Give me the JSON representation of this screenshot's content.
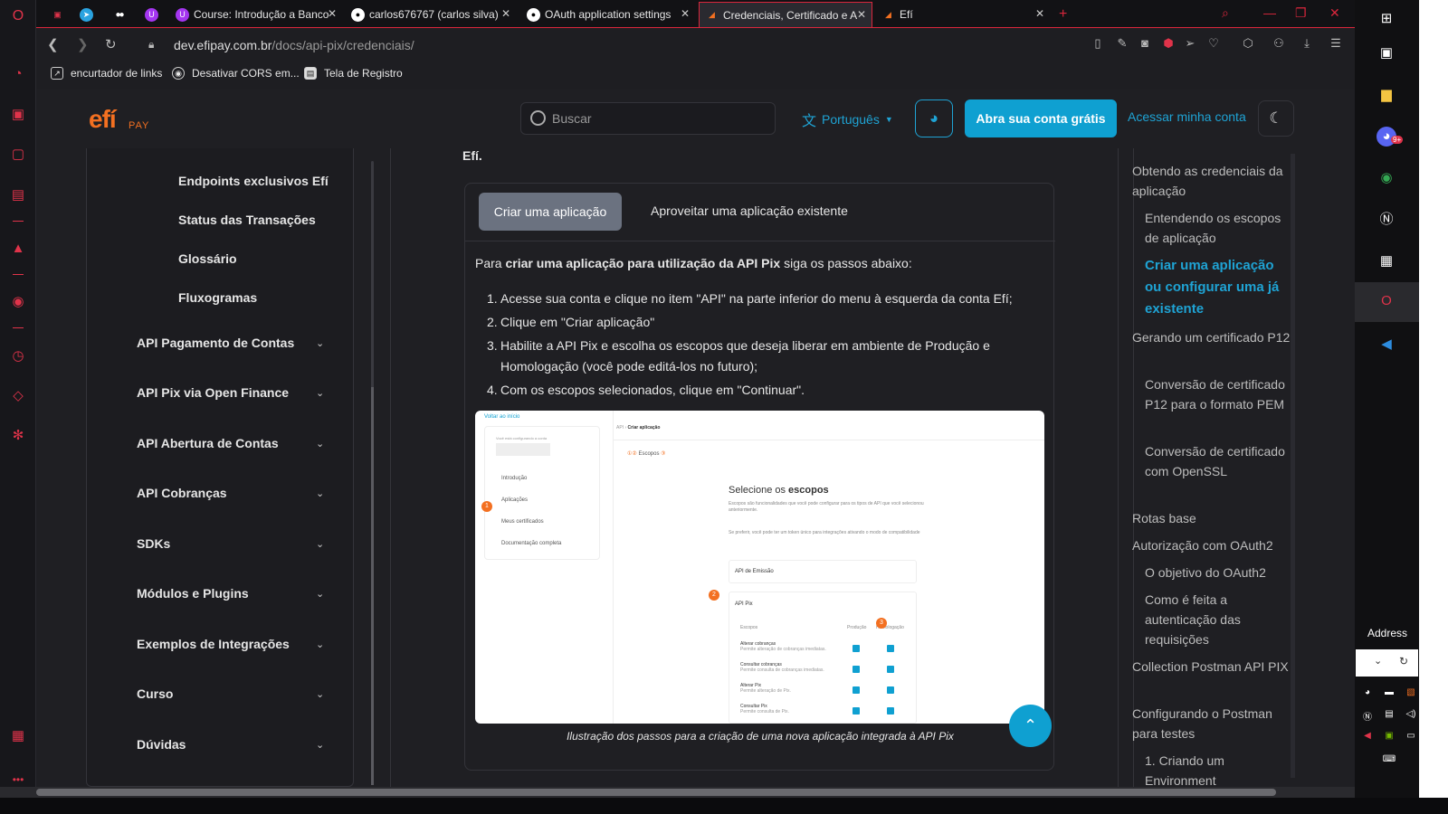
{
  "browser": {
    "tabs": [
      {
        "label": "",
        "icon": "gamepad-icon"
      },
      {
        "label": "",
        "icon": "telegram-icon"
      },
      {
        "label": "",
        "icon": "medium-icon"
      },
      {
        "label": "",
        "icon": "udemy-icon"
      },
      {
        "label": "Course: Introdução a Banco",
        "icon": "udemy-icon"
      },
      {
        "label": "carlos676767 (carlos silva)",
        "icon": "github-icon"
      },
      {
        "label": "OAuth application settings",
        "icon": "github-icon"
      },
      {
        "label": "Credenciais, Certificado e A",
        "icon": "efi-icon"
      },
      {
        "label": "Efí",
        "icon": "efi-icon"
      }
    ],
    "new_tab": "+",
    "url_domain": "dev.efipay.com.br",
    "url_path": "/docs/api-pix/credenciais/",
    "bookmarks": [
      "encurtador de links",
      "Desativar CORS em...",
      "Tela de Registro"
    ]
  },
  "header": {
    "logo": "efí",
    "logo_sub": "PAY",
    "search_placeholder": "Buscar",
    "language": "Português",
    "cta": "Abra sua conta grátis",
    "login": "Acessar minha conta"
  },
  "sidebar": {
    "sub_items": [
      "Endpoints exclusivos Efí",
      "Status das Transações",
      "Glossário",
      "Fluxogramas"
    ],
    "items": [
      "API Pagamento de Contas",
      "API Pix via Open Finance",
      "API Abertura de Contas",
      "API Cobranças",
      "SDKs",
      "Módulos e Plugins",
      "Exemplos de Integrações",
      "Curso",
      "Dúvidas"
    ]
  },
  "content": {
    "top_text": "Efí.",
    "tab_active": "Criar uma aplicação",
    "tab_other": "Aproveitar uma aplicação existente",
    "intro_prefix": "Para ",
    "intro_bold": "criar uma aplicação para utilização da API Pix",
    "intro_suffix": " siga os passos abaixo:",
    "steps": [
      "Acesse sua conta e clique no item \"API\" na parte inferior do menu à esquerda da conta Efí;",
      "Clique em \"Criar aplicação\"",
      "Habilite a API Pix e escolha os escopos que deseja liberar em ambiente de Produção e Homologação (você pode editá-los no futuro);",
      "Com os escopos selecionados, clique em \"Continuar\"."
    ],
    "caption": "Ilustração dos passos para a criação de uma nova aplicação integrada à API Pix",
    "screenshot": {
      "back": "Voltar ao início",
      "account_label": "Você está configurando a conta",
      "menu": [
        "Introdução",
        "Aplicações",
        "Meus certificados",
        "Documentação completa"
      ],
      "crumb": [
        "API",
        "Criar aplicação"
      ],
      "step_label": "Escopos",
      "heading_prefix": "Selecione os ",
      "heading_bold": "escopos",
      "desc1": "Escopos são funcionalidades que você pode configurar para os tipos de API que você selecionou anteriormente.",
      "desc2": "Se preferir, você pode ter um token único para integrações ativando o modo de compatibilidade",
      "api_emissao": "API de Emissão",
      "api_pix": "API Pix",
      "col_scopes": "Escopos",
      "col_prod": "Produção",
      "col_hom": "Homologação",
      "rows": [
        {
          "title": "Alterar cobranças",
          "desc": "Permite alteração de cobranças imediatas."
        },
        {
          "title": "Consultar cobranças",
          "desc": "Permite consulta de cobranças imediatas."
        },
        {
          "title": "Alterar Pix",
          "desc": "Permite alteração de Pix."
        },
        {
          "title": "Consultar Pix",
          "desc": "Permite consulta de Pix."
        }
      ],
      "markers": [
        "1",
        "2",
        "3"
      ]
    }
  },
  "toc": {
    "items": [
      {
        "label": "Obtendo as credenciais da aplicação",
        "level": 1
      },
      {
        "label": "Entendendo os escopos de aplicação",
        "level": 2
      },
      {
        "label": "Criar uma aplicação ou configurar uma já existente",
        "level": 2,
        "active": true
      },
      {
        "label": "Gerando um certificado P12",
        "level": 1
      },
      {
        "label": "Conversão de certificado P12 para o formato PEM",
        "level": 2
      },
      {
        "label": "Conversão de certificado com OpenSSL",
        "level": 2
      },
      {
        "label": "Rotas base",
        "level": 1
      },
      {
        "label": "Autorização com OAuth2",
        "level": 1
      },
      {
        "label": "O objetivo do OAuth2",
        "level": 2
      },
      {
        "label": "Como é feita a autenticação das requisições",
        "level": 2
      },
      {
        "label": "Collection Postman API PIX",
        "level": 1
      },
      {
        "label": "Configurando o Postman para testes",
        "level": 1
      },
      {
        "label": "1. Criando um Environment",
        "level": 2
      }
    ]
  },
  "taskbar": {
    "address_label": "Address",
    "badge": "9+"
  },
  "colors": {
    "accent": "#0fa0d1",
    "brand": "#f37021",
    "opera": "#d9263c"
  }
}
